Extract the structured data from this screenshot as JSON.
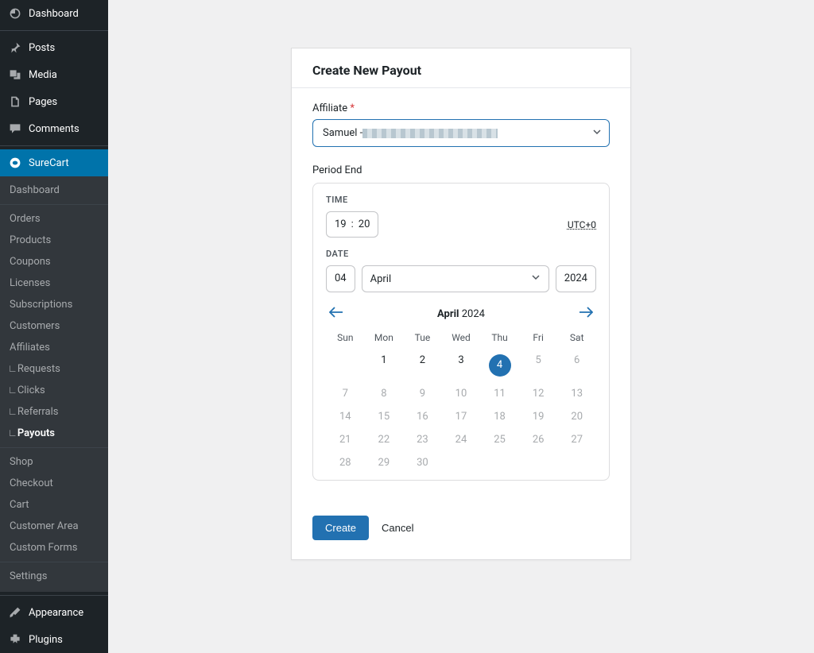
{
  "sidebar": {
    "dashboard": "Dashboard",
    "posts": "Posts",
    "media": "Media",
    "pages": "Pages",
    "comments": "Comments",
    "surecart": "SureCart",
    "appearance": "Appearance",
    "plugins": "Plugins",
    "sub": {
      "dashboard": "Dashboard",
      "orders": "Orders",
      "products": "Products",
      "coupons": "Coupons",
      "licenses": "Licenses",
      "subscriptions": "Subscriptions",
      "customers": "Customers",
      "affiliates": "Affiliates",
      "requests": "Requests",
      "clicks": "Clicks",
      "referrals": "Referrals",
      "payouts": "Payouts",
      "shop": "Shop",
      "checkout": "Checkout",
      "cart": "Cart",
      "customer_area": "Customer Area",
      "custom_forms": "Custom Forms",
      "settings": "Settings"
    }
  },
  "page": {
    "title": "Create New Payout",
    "affiliate_label": "Affiliate",
    "required_mark": "*",
    "affiliate_value_prefix": "Samuel - ",
    "period_end_label": "Period End",
    "time_label": "TIME",
    "time_hour": "19",
    "time_sep": ":",
    "time_min": "20",
    "tz": "UTC+0",
    "date_label": "DATE",
    "date_day": "04",
    "date_month": "April",
    "date_year": "2024",
    "cal_month": "April",
    "cal_year": "2024",
    "weekdays": [
      "Sun",
      "Mon",
      "Tue",
      "Wed",
      "Thu",
      "Fri",
      "Sat"
    ],
    "days_row1": [
      "",
      "1",
      "2",
      "3",
      "4",
      "5",
      "6"
    ],
    "days_row2": [
      "7",
      "8",
      "9",
      "10",
      "11",
      "12",
      "13"
    ],
    "days_row3": [
      "14",
      "15",
      "16",
      "17",
      "18",
      "19",
      "20"
    ],
    "days_row4": [
      "21",
      "22",
      "23",
      "24",
      "25",
      "26",
      "27"
    ],
    "days_row5": [
      "28",
      "29",
      "30",
      "",
      "",
      "",
      ""
    ],
    "selected_day": "4",
    "create": "Create",
    "cancel": "Cancel"
  }
}
